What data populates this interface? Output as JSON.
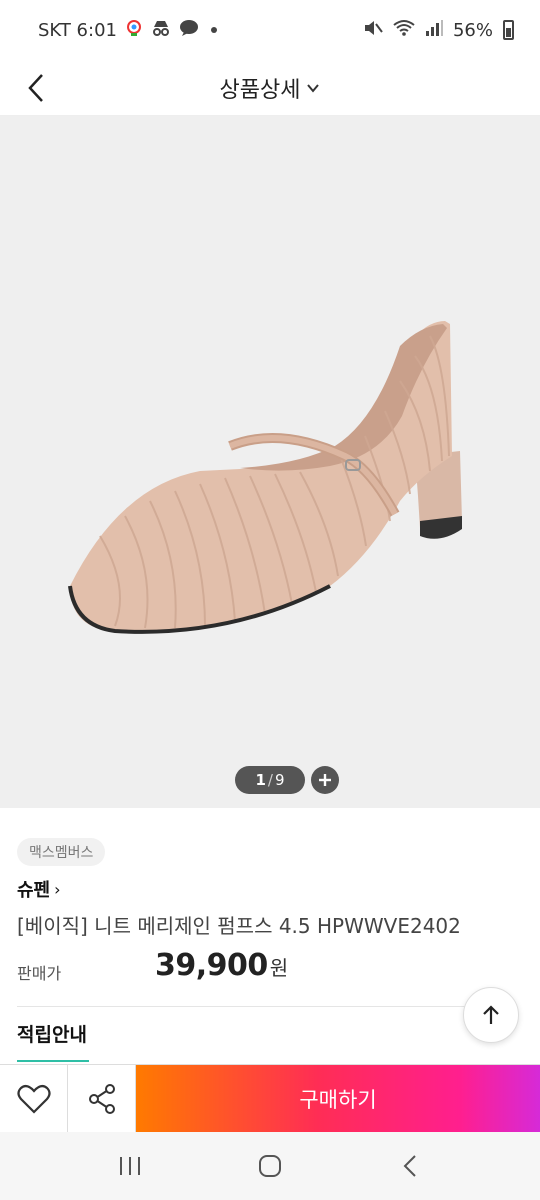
{
  "status_bar": {
    "carrier_time": "SKT 6:01",
    "battery": "56%"
  },
  "header": {
    "title": "상품상세"
  },
  "gallery": {
    "current": "1",
    "separator": "/",
    "total": "9"
  },
  "product": {
    "badge": "맥스멤버스",
    "brand": "슈펜",
    "brand_arrow": "›",
    "name": "[베이직] 니트 메리제인 펌프스 4.5 HPWWVE2402",
    "price_label": "판매가",
    "price": "39,900",
    "price_unit": "원",
    "section_title": "적립안내"
  },
  "action_bar": {
    "buy_label": "구매하기"
  },
  "colors": {
    "accent_teal": "#2fbfa6",
    "buy_gradient_start": "#ff7a00",
    "buy_gradient_end": "#d62ad8"
  }
}
